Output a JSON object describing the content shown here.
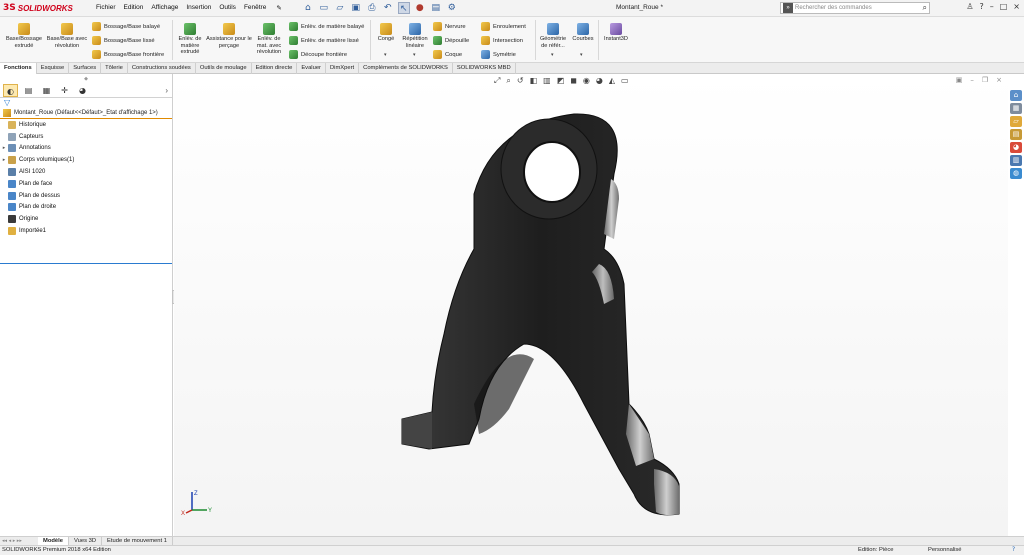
{
  "app": {
    "brand_ds": "3S",
    "brand_name": "SOLIDWORKS",
    "document_title": "Montant_Roue *"
  },
  "menu": [
    "Fichier",
    "Edition",
    "Affichage",
    "Insertion",
    "Outils",
    "Fenêtre"
  ],
  "search": {
    "placeholder": "Rechercher des commandes"
  },
  "ribbon": {
    "base_extrude": "Base/Bossage extrudé",
    "base_revolve": "Base/Base avec révolution",
    "bossage_balaye": "Bossage/Base balayé",
    "bossage_lisse": "Bossage/Base lissé",
    "bossage_frontiere": "Bossage/Base frontière",
    "enlev_extrude": "Enlèv. de matière extrudé",
    "assistance_percage": "Assistance pour le perçage",
    "enlev_revolution": "Enlèv. de mat. avec révolution",
    "enlev_balaye": "Enlèv. de matière balayé",
    "enlev_lisse": "Enlèv. de matière lissé",
    "decoupe_frontiere": "Découpe frontière",
    "conge": "Congé",
    "repetition": "Répétition linéaire",
    "nervure": "Nervure",
    "depouille": "Dépouille",
    "coque": "Coque",
    "enroulement": "Enroulement",
    "intersection": "Intersection",
    "symetrie": "Symétrie",
    "geometrie": "Géométrie de référ...",
    "courbes": "Courbes",
    "instant3d": "Instant3D"
  },
  "command_tabs": [
    "Fonctions",
    "Esquisse",
    "Surfaces",
    "Tôlerie",
    "Constructions soudées",
    "Outils de moulage",
    "Edition directe",
    "Evaluer",
    "DimXpert",
    "Compléments de SOLIDWORKS",
    "SOLIDWORKS MBD"
  ],
  "tree": {
    "root": "Montant_Roue  (Défaut<<Défaut>_Etat d'affichage 1>)",
    "items": [
      {
        "label": "Historique",
        "expandable": false,
        "icon": "history-folder-icon"
      },
      {
        "label": "Capteurs",
        "expandable": false,
        "icon": "sensor-icon"
      },
      {
        "label": "Annotations",
        "expandable": true,
        "icon": "annotation-icon"
      },
      {
        "label": "Corps volumiques(1)",
        "expandable": true,
        "icon": "solid-bodies-icon"
      },
      {
        "label": "AISI 1020",
        "expandable": false,
        "icon": "material-icon"
      },
      {
        "label": "Plan de face",
        "expandable": false,
        "icon": "plane-icon"
      },
      {
        "label": "Plan de dessus",
        "expandable": false,
        "icon": "plane-icon"
      },
      {
        "label": "Plan de droite",
        "expandable": false,
        "icon": "plane-icon"
      },
      {
        "label": "Origine",
        "expandable": false,
        "icon": "origin-icon"
      },
      {
        "label": "Importée1",
        "expandable": false,
        "icon": "imported-feature-icon"
      }
    ]
  },
  "triad": {
    "x": "X",
    "y": "Y",
    "z": "Z"
  },
  "bottom_tabs": [
    "Modèle",
    "Vues 3D",
    "Etude de mouvement 1"
  ],
  "status": {
    "left": "SOLIDWORKS Premium 2018 x64 Edition",
    "mode": "Edition: Pièce",
    "custom": "Personnalisé"
  },
  "colors": {
    "brand_red": "#d0021b",
    "selection_orange": "#e08a00",
    "accent_blue": "#2a7bd0"
  }
}
